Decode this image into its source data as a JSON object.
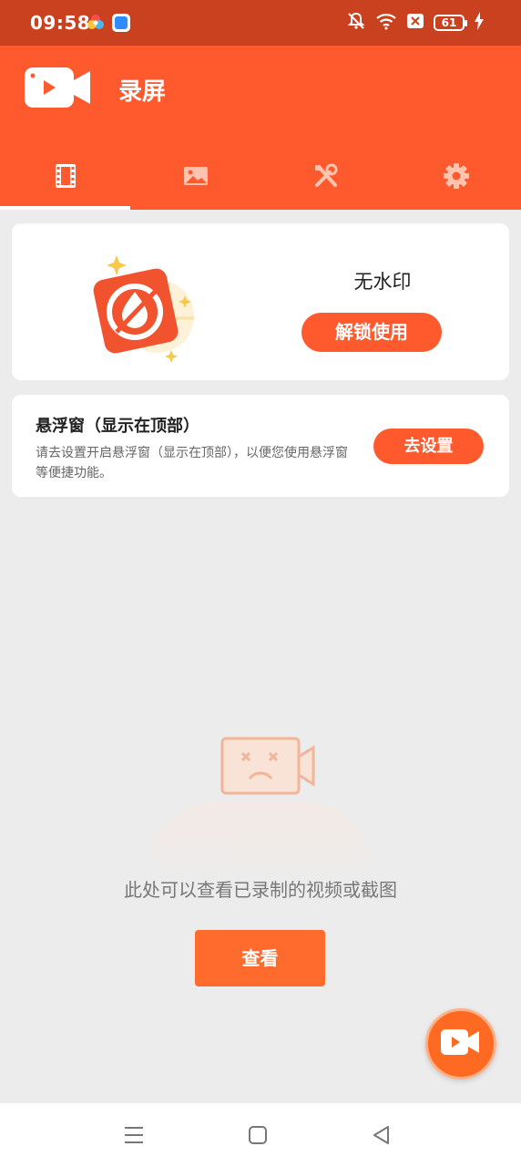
{
  "status_bar": {
    "time": "09:58",
    "battery": "61",
    "icons": [
      "colorful-app-icon",
      "blue-app-icon",
      "mute-bell-icon",
      "wifi-icon",
      "x-box-icon",
      "battery-icon",
      "charging-icon"
    ]
  },
  "header": {
    "title": "录屏",
    "tabs": [
      {
        "name": "videos",
        "icon": "film-icon",
        "active": true
      },
      {
        "name": "images",
        "icon": "image-icon",
        "active": false
      },
      {
        "name": "tools",
        "icon": "tools-icon",
        "active": false
      },
      {
        "name": "settings",
        "icon": "gear-icon",
        "active": false
      }
    ]
  },
  "promo": {
    "title": "无水印",
    "button": "解锁使用"
  },
  "floating_window": {
    "title": "悬浮窗（显示在顶部）",
    "description": "请去设置开启悬浮窗（显示在顶部），以便您使用悬浮窗等便捷功能。",
    "button": "去设置"
  },
  "empty_state": {
    "text": "此处可以查看已录制的视频或截图",
    "button": "查看"
  },
  "colors": {
    "accent": "#ff5a2d",
    "status_bar": "#c9411f",
    "background": "#ececec"
  }
}
